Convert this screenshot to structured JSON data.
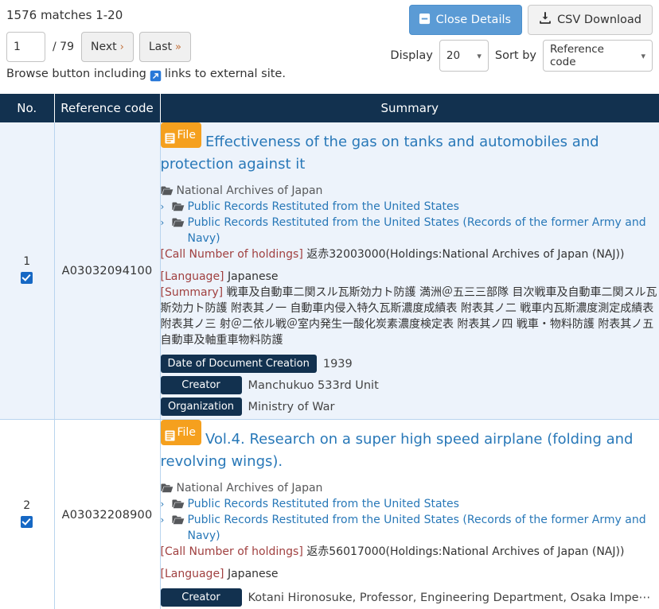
{
  "toolbar": {
    "matches_text": "1576 matches 1-20",
    "page_value": "1",
    "page_total": "/ 79",
    "next_label": "Next",
    "next_chevron": "›",
    "last_label": "Last",
    "last_chevron": "»",
    "browse_note_before": "Browse button including",
    "browse_note_after": "links to external site.",
    "external_link_icon": "external-link-icon",
    "close_details_label": "Close Details",
    "close_details_icon": "minus-square-icon",
    "csv_download_label": "CSV Download",
    "csv_download_icon": "download-icon",
    "display_label": "Display",
    "display_value": "20",
    "sort_label": "Sort by",
    "sort_value": "Reference code",
    "caret_icon": "chevron-down-icon",
    "accent_blue": "#5b9bd5",
    "header_navy": "#12314f",
    "badge_orange": "#f5a01e"
  },
  "table": {
    "columns": [
      "No.",
      "Reference code",
      "Summary"
    ],
    "rows": [
      {
        "no": "1",
        "checked": true,
        "reference_code": "A03032094100",
        "badge": "File",
        "title": "Effectiveness of the gas on tanks and automobiles and protection against it",
        "hierarchy": [
          {
            "arrow": "",
            "label": "National Archives of Japan",
            "link": false
          },
          {
            "arrow": "›",
            "label": "Public Records Restituted from the United States",
            "link": true
          },
          {
            "arrow": "›",
            "label": "Public Records Restituted from the United States (Records of the former Army and Navy)",
            "link": true
          }
        ],
        "call_number_key": "[Call Number of holdings]",
        "call_number_value": "返赤32003000(Holdings:National Archives of Japan (NAJ))",
        "language_key": "[Language]",
        "language_value": "Japanese",
        "summary_key": "[Summary]",
        "summary_value": "戦車及自動車二関スル瓦斯効力ト防護 満洲＠五三三部隊 目次戦車及自動車二関スル瓦斯効力ト防護 附表其ノ一 自動車内侵入特久瓦斯濃度成績表 附表其ノ二 戦車内瓦斯濃度測定成績表 附表其ノ三 射＠二依ル戦＠室内発生一酸化炭素濃度検定表 附表其ノ四 戦車・物料防護 附表其ノ五 自動車及軸重車物料防護",
        "tags": [
          {
            "label": "Date of Document Creation",
            "value": "1939",
            "width": "auto"
          },
          {
            "label": "Creator",
            "value": "Manchukuo 533rd Unit",
            "width": "creator"
          },
          {
            "label": "Organization",
            "value": "Ministry of War",
            "width": "org"
          }
        ]
      },
      {
        "no": "2",
        "checked": true,
        "reference_code": "A03032208900",
        "badge": "File",
        "title": "Vol.4. Research on a super high speed airplane (folding and revolving wings).",
        "hierarchy": [
          {
            "arrow": "",
            "label": "National Archives of Japan",
            "link": false
          },
          {
            "arrow": "›",
            "label": "Public Records Restituted from the United States",
            "link": true
          },
          {
            "arrow": "›",
            "label": "Public Records Restituted from the United States (Records of the former Army and Navy)",
            "link": true
          }
        ],
        "call_number_key": "[Call Number of holdings]",
        "call_number_value": "返赤56017000(Holdings:National Archives of Japan (NAJ))",
        "language_key": "[Language]",
        "language_value": "Japanese",
        "summary_key": "",
        "summary_value": "",
        "tags": [
          {
            "label": "Creator",
            "value": "Kotani Hironosuke, Professor, Engineering Department, Osaka Impe⋯",
            "width": "creator"
          }
        ]
      }
    ]
  }
}
